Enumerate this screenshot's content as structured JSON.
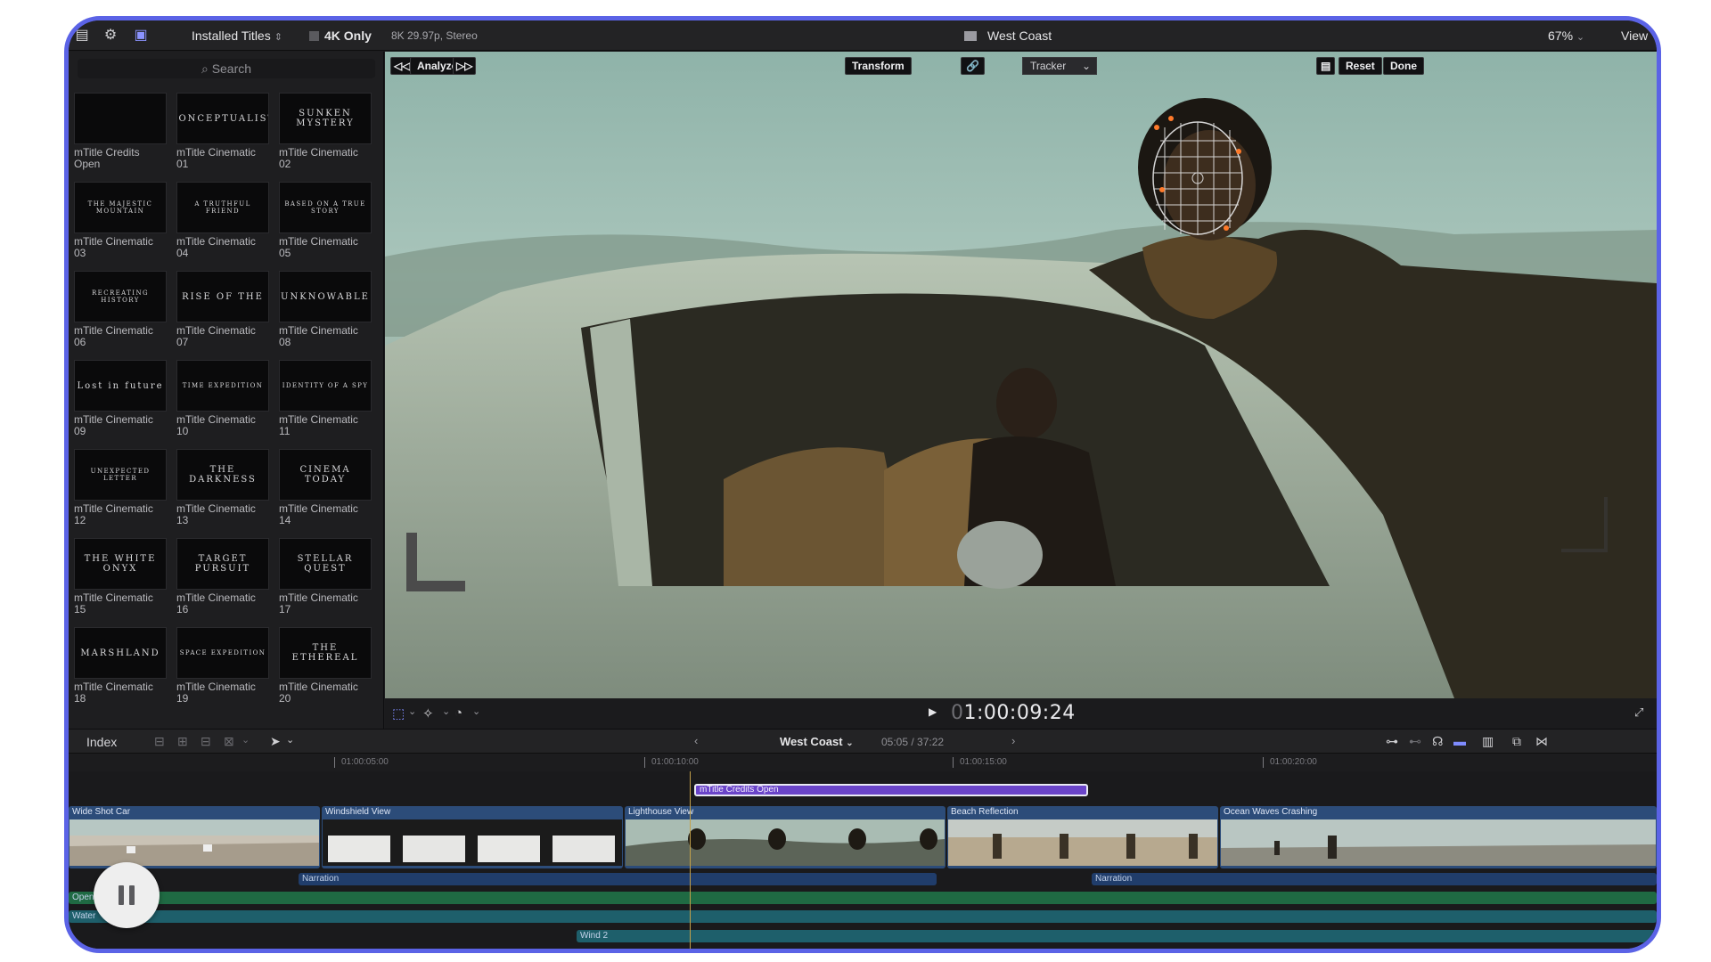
{
  "toolbar": {
    "installed_titles": "Installed Titles",
    "four_k_only": "4K Only",
    "format": "8K 29.97p, Stereo",
    "project_title": "West Coast",
    "zoom": "67%",
    "view": "View"
  },
  "browser": {
    "search_placeholder": "Search",
    "items": [
      {
        "thumb": "",
        "caption": "mTitle Credits Open"
      },
      {
        "thumb": "CONCEPTUALIST",
        "caption": "mTitle Cinematic 01"
      },
      {
        "thumb": "SUNKEN MYSTERY",
        "caption": "mTitle Cinematic 02"
      },
      {
        "thumb": "THE MAJESTIC MOUNTAIN",
        "caption": "mTitle Cinematic 03"
      },
      {
        "thumb": "A TRUTHFUL FRIEND",
        "caption": "mTitle Cinematic 04"
      },
      {
        "thumb": "BASED ON A TRUE STORY",
        "caption": "mTitle Cinematic 05"
      },
      {
        "thumb": "RECREATING HISTORY",
        "caption": "mTitle Cinematic 06"
      },
      {
        "thumb": "RISE OF THE",
        "caption": "mTitle Cinematic 07"
      },
      {
        "thumb": "UNKNOWABLE",
        "caption": "mTitle Cinematic 08"
      },
      {
        "thumb": "Lost in future",
        "caption": "mTitle Cinematic 09"
      },
      {
        "thumb": "TIME EXPEDITION",
        "caption": "mTitle Cinematic 10"
      },
      {
        "thumb": "IDENTITY OF A SPY",
        "caption": "mTitle Cinematic 11"
      },
      {
        "thumb": "UNEXPECTED LETTER",
        "caption": "mTitle Cinematic 12"
      },
      {
        "thumb": "THE DARKNESS",
        "caption": "mTitle Cinematic 13"
      },
      {
        "thumb": "CINEMA TODAY",
        "caption": "mTitle Cinematic 14"
      },
      {
        "thumb": "THE WHITE ONYX",
        "caption": "mTitle Cinematic 15"
      },
      {
        "thumb": "TARGET PURSUIT",
        "caption": "mTitle Cinematic 16"
      },
      {
        "thumb": "STELLAR QUEST",
        "caption": "mTitle Cinematic 17"
      },
      {
        "thumb": "MARSHLAND",
        "caption": "mTitle Cinematic 18"
      },
      {
        "thumb": "SPACE EXPEDITION",
        "caption": "mTitle Cinematic 19"
      },
      {
        "thumb": "THE ETHEREAL",
        "caption": "mTitle Cinematic 20"
      }
    ]
  },
  "viewer": {
    "analyze": "Analyze",
    "transform": "Transform",
    "tracker": "Tracker",
    "reset": "Reset",
    "done": "Done",
    "timecode_dim": "0",
    "timecode": "1:00:09:24"
  },
  "timeline": {
    "index": "Index",
    "project": "West Coast",
    "duration": "05:05 / 37:22",
    "ruler": [
      "01:00:05:00",
      "01:00:10:00",
      "01:00:15:00",
      "01:00:20:00"
    ],
    "title_clip": "mTitle Credits Open",
    "video_clips": [
      "Wide Shot Car",
      "Windshield View",
      "Lighthouse View",
      "Beach Reflection",
      "Ocean Waves Crashing"
    ],
    "narration_1": "Narration",
    "narration_2": "Narration",
    "audio_opening": "Opening",
    "audio_water": "Water",
    "audio_wind": "Wind 2"
  },
  "colors": {
    "accent": "#5b63e6",
    "title_clip": "#6a44c9",
    "video_clip": "#2c4c79",
    "audio_green": "#1f6a43",
    "audio_teal": "#1e5f6b"
  }
}
